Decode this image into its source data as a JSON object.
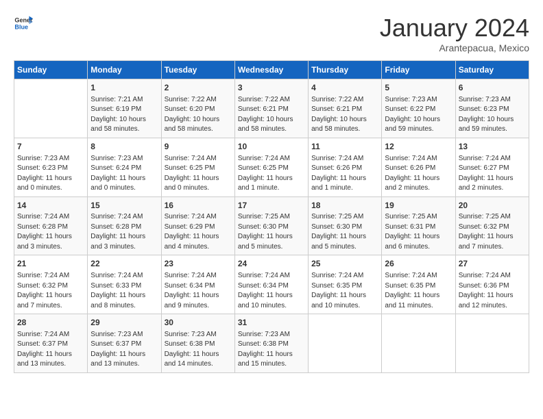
{
  "header": {
    "logo_general": "General",
    "logo_blue": "Blue",
    "month_title": "January 2024",
    "subtitle": "Arantepacua, Mexico"
  },
  "days_of_week": [
    "Sunday",
    "Monday",
    "Tuesday",
    "Wednesday",
    "Thursday",
    "Friday",
    "Saturday"
  ],
  "weeks": [
    [
      {
        "day": "",
        "info": ""
      },
      {
        "day": "1",
        "info": "Sunrise: 7:21 AM\nSunset: 6:19 PM\nDaylight: 10 hours\nand 58 minutes."
      },
      {
        "day": "2",
        "info": "Sunrise: 7:22 AM\nSunset: 6:20 PM\nDaylight: 10 hours\nand 58 minutes."
      },
      {
        "day": "3",
        "info": "Sunrise: 7:22 AM\nSunset: 6:21 PM\nDaylight: 10 hours\nand 58 minutes."
      },
      {
        "day": "4",
        "info": "Sunrise: 7:22 AM\nSunset: 6:21 PM\nDaylight: 10 hours\nand 58 minutes."
      },
      {
        "day": "5",
        "info": "Sunrise: 7:23 AM\nSunset: 6:22 PM\nDaylight: 10 hours\nand 59 minutes."
      },
      {
        "day": "6",
        "info": "Sunrise: 7:23 AM\nSunset: 6:23 PM\nDaylight: 10 hours\nand 59 minutes."
      }
    ],
    [
      {
        "day": "7",
        "info": "Sunrise: 7:23 AM\nSunset: 6:23 PM\nDaylight: 11 hours\nand 0 minutes."
      },
      {
        "day": "8",
        "info": "Sunrise: 7:23 AM\nSunset: 6:24 PM\nDaylight: 11 hours\nand 0 minutes."
      },
      {
        "day": "9",
        "info": "Sunrise: 7:24 AM\nSunset: 6:25 PM\nDaylight: 11 hours\nand 0 minutes."
      },
      {
        "day": "10",
        "info": "Sunrise: 7:24 AM\nSunset: 6:25 PM\nDaylight: 11 hours\nand 1 minute."
      },
      {
        "day": "11",
        "info": "Sunrise: 7:24 AM\nSunset: 6:26 PM\nDaylight: 11 hours\nand 1 minute."
      },
      {
        "day": "12",
        "info": "Sunrise: 7:24 AM\nSunset: 6:26 PM\nDaylight: 11 hours\nand 2 minutes."
      },
      {
        "day": "13",
        "info": "Sunrise: 7:24 AM\nSunset: 6:27 PM\nDaylight: 11 hours\nand 2 minutes."
      }
    ],
    [
      {
        "day": "14",
        "info": "Sunrise: 7:24 AM\nSunset: 6:28 PM\nDaylight: 11 hours\nand 3 minutes."
      },
      {
        "day": "15",
        "info": "Sunrise: 7:24 AM\nSunset: 6:28 PM\nDaylight: 11 hours\nand 3 minutes."
      },
      {
        "day": "16",
        "info": "Sunrise: 7:24 AM\nSunset: 6:29 PM\nDaylight: 11 hours\nand 4 minutes."
      },
      {
        "day": "17",
        "info": "Sunrise: 7:25 AM\nSunset: 6:30 PM\nDaylight: 11 hours\nand 5 minutes."
      },
      {
        "day": "18",
        "info": "Sunrise: 7:25 AM\nSunset: 6:30 PM\nDaylight: 11 hours\nand 5 minutes."
      },
      {
        "day": "19",
        "info": "Sunrise: 7:25 AM\nSunset: 6:31 PM\nDaylight: 11 hours\nand 6 minutes."
      },
      {
        "day": "20",
        "info": "Sunrise: 7:25 AM\nSunset: 6:32 PM\nDaylight: 11 hours\nand 7 minutes."
      }
    ],
    [
      {
        "day": "21",
        "info": "Sunrise: 7:24 AM\nSunset: 6:32 PM\nDaylight: 11 hours\nand 7 minutes."
      },
      {
        "day": "22",
        "info": "Sunrise: 7:24 AM\nSunset: 6:33 PM\nDaylight: 11 hours\nand 8 minutes."
      },
      {
        "day": "23",
        "info": "Sunrise: 7:24 AM\nSunset: 6:34 PM\nDaylight: 11 hours\nand 9 minutes."
      },
      {
        "day": "24",
        "info": "Sunrise: 7:24 AM\nSunset: 6:34 PM\nDaylight: 11 hours\nand 10 minutes."
      },
      {
        "day": "25",
        "info": "Sunrise: 7:24 AM\nSunset: 6:35 PM\nDaylight: 11 hours\nand 10 minutes."
      },
      {
        "day": "26",
        "info": "Sunrise: 7:24 AM\nSunset: 6:35 PM\nDaylight: 11 hours\nand 11 minutes."
      },
      {
        "day": "27",
        "info": "Sunrise: 7:24 AM\nSunset: 6:36 PM\nDaylight: 11 hours\nand 12 minutes."
      }
    ],
    [
      {
        "day": "28",
        "info": "Sunrise: 7:24 AM\nSunset: 6:37 PM\nDaylight: 11 hours\nand 13 minutes."
      },
      {
        "day": "29",
        "info": "Sunrise: 7:23 AM\nSunset: 6:37 PM\nDaylight: 11 hours\nand 13 minutes."
      },
      {
        "day": "30",
        "info": "Sunrise: 7:23 AM\nSunset: 6:38 PM\nDaylight: 11 hours\nand 14 minutes."
      },
      {
        "day": "31",
        "info": "Sunrise: 7:23 AM\nSunset: 6:38 PM\nDaylight: 11 hours\nand 15 minutes."
      },
      {
        "day": "",
        "info": ""
      },
      {
        "day": "",
        "info": ""
      },
      {
        "day": "",
        "info": ""
      }
    ]
  ]
}
